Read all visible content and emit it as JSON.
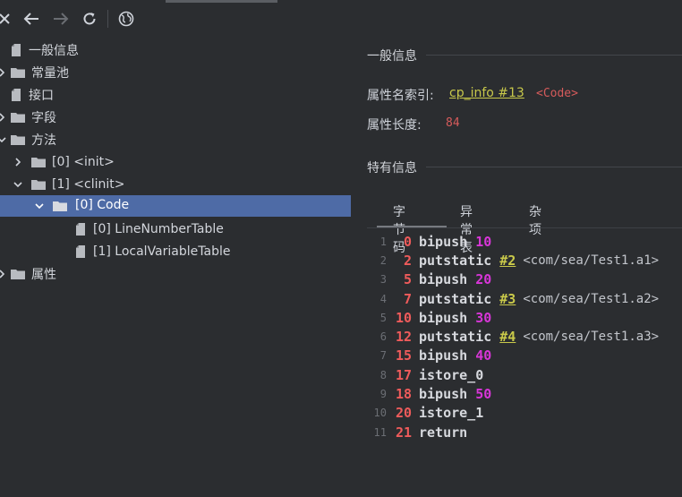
{
  "toolbar": {
    "buttons": [
      {
        "name": "close-icon",
        "glyph": "✕"
      },
      {
        "name": "back-icon",
        "glyph": "←"
      },
      {
        "name": "forward-icon",
        "glyph": "→"
      },
      {
        "name": "refresh-icon",
        "glyph": "⟳"
      },
      {
        "name": "web-icon",
        "glyph": "◍"
      }
    ]
  },
  "tree": {
    "items": [
      {
        "label": "一般信息",
        "type": "file",
        "expanded": null,
        "selected": false
      },
      {
        "label": "常量池",
        "type": "folder",
        "expanded": false,
        "selected": false
      },
      {
        "label": "接口",
        "type": "file",
        "expanded": null,
        "selected": false
      },
      {
        "label": "字段",
        "type": "folder",
        "expanded": false,
        "selected": false
      },
      {
        "label": "方法",
        "type": "folder",
        "expanded": true,
        "selected": false
      },
      {
        "label": "[0] <init>",
        "type": "folder",
        "expanded": false,
        "selected": false
      },
      {
        "label": "[1] <clinit>",
        "type": "folder",
        "expanded": true,
        "selected": false
      },
      {
        "label": "[0] Code",
        "type": "folder",
        "expanded": true,
        "selected": true
      },
      {
        "label": "[0] LineNumberTable",
        "type": "file",
        "expanded": null,
        "selected": false
      },
      {
        "label": "[1] LocalVariableTable",
        "type": "file",
        "expanded": null,
        "selected": false
      },
      {
        "label": "属性",
        "type": "folder",
        "expanded": false,
        "selected": false
      }
    ]
  },
  "details": {
    "general_title": "一般信息",
    "name_index_label": "属性名索引:",
    "name_index_link": "cp_info #13",
    "name_index_ref": "<Code>",
    "length_label": "属性长度:",
    "length_value": "84",
    "specific_title": "特有信息",
    "tabs": [
      "字节码",
      "异常表",
      "杂项"
    ],
    "active_tab": "字节码"
  },
  "bytecode": [
    {
      "line": "1",
      "offset": "0",
      "op": "bipush",
      "arg": "10"
    },
    {
      "line": "2",
      "offset": "2",
      "op": "putstatic",
      "cpref": "#2",
      "comment": "<com/sea/Test1.a1>"
    },
    {
      "line": "3",
      "offset": "5",
      "op": "bipush",
      "arg": "20"
    },
    {
      "line": "4",
      "offset": "7",
      "op": "putstatic",
      "cpref": "#3",
      "comment": "<com/sea/Test1.a2>"
    },
    {
      "line": "5",
      "offset": "10",
      "op": "bipush",
      "arg": "30"
    },
    {
      "line": "6",
      "offset": "12",
      "op": "putstatic",
      "cpref": "#4",
      "comment": "<com/sea/Test1.a3>"
    },
    {
      "line": "7",
      "offset": "15",
      "op": "bipush",
      "arg": "40"
    },
    {
      "line": "8",
      "offset": "17",
      "op": "istore_0"
    },
    {
      "line": "9",
      "offset": "18",
      "op": "bipush",
      "arg": "50"
    },
    {
      "line": "10",
      "offset": "20",
      "op": "istore_1"
    },
    {
      "line": "11",
      "offset": "21",
      "op": "return"
    }
  ]
}
